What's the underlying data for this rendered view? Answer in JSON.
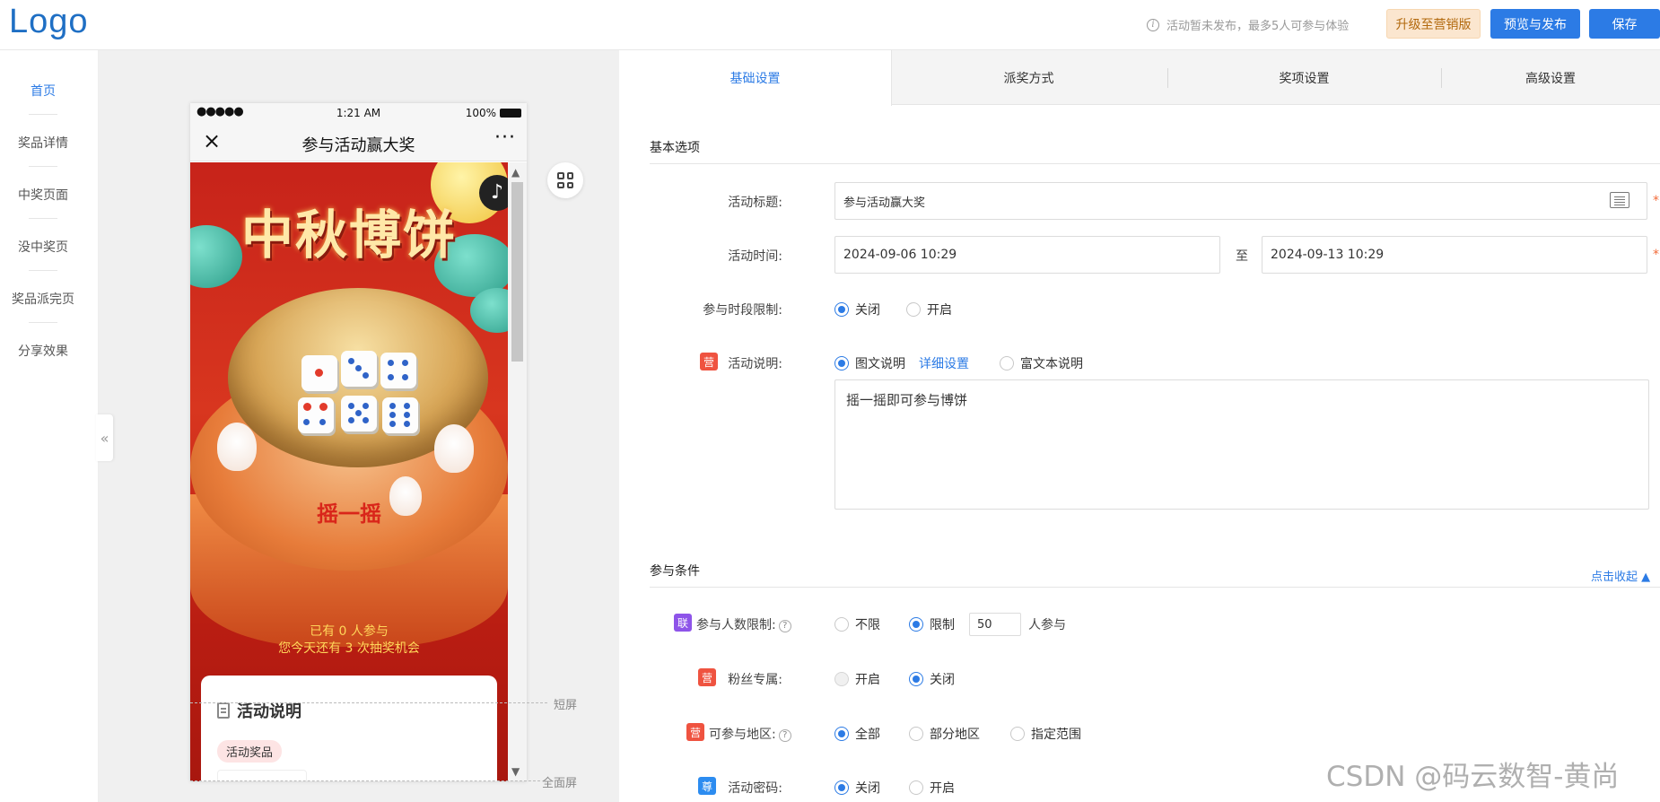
{
  "header": {
    "logo": "Logo",
    "hint": "活动暂未发布，最多5人可参与体验",
    "upgrade_label": "升级至营销版",
    "preview_label": "预览与发布",
    "save_label": "保存",
    "colors": {
      "primary": "#2c7be5",
      "upgrade_bg": "#fbe6cf",
      "upgrade_text": "#b2690d"
    }
  },
  "nav": {
    "items": [
      {
        "label": "首页",
        "active": true
      },
      {
        "label": "奖品详情"
      },
      {
        "label": "中奖页面"
      },
      {
        "label": "没中奖页"
      },
      {
        "label": "奖品派完页"
      },
      {
        "label": "分享效果"
      }
    ],
    "collapse_icon": "double-chevron-left-icon"
  },
  "phone": {
    "signal": "●●●●●",
    "time": "1:21 AM",
    "battery": "100%",
    "title": "参与活动赢大奖",
    "close_icon": "×",
    "more_icon": "···",
    "poster_title": "中秋博饼",
    "shake_label": "摇一摇",
    "joined_line1": "已有 0 人参与",
    "joined_line2": "您今天还有 3 次抽奖机会",
    "desc_title": "活动说明",
    "prize_tag": "活动奖品"
  },
  "canvas": {
    "short_screen": "短屏",
    "full_screen": "全面屏",
    "qr_icon": "qrcode-grid-icon"
  },
  "tabs": [
    {
      "label": "基础设置",
      "active": true
    },
    {
      "label": "派奖方式"
    },
    {
      "label": "奖项设置"
    },
    {
      "label": "高级设置"
    }
  ],
  "basic": {
    "section": "基本选项",
    "title_label": "活动标题:",
    "title_value": "参与活动赢大奖",
    "time_label": "活动时间:",
    "start_time": "2024-09-06 10:29",
    "to": "至",
    "end_time": "2024-09-13 10:29",
    "period_label": "参与时段限制:",
    "period_off": "关闭",
    "period_on": "开启",
    "desc_label": "活动说明:",
    "desc_badge": "营",
    "desc_opt1": "图文说明",
    "desc_link": "详细设置",
    "desc_opt2": "富文本说明",
    "desc_text": "摇一摇即可参与博饼",
    "required": "*"
  },
  "conditions": {
    "section": "参与条件",
    "collapse_link": "点击收起 ▲",
    "count_badge": "联",
    "count_label": "参与人数限制:",
    "count_opt1": "不限",
    "count_opt2": "限制",
    "count_value": "50",
    "count_suffix": "人参与",
    "fans_badge": "营",
    "fans_label": "粉丝专属:",
    "fans_on": "开启",
    "fans_off": "关闭",
    "region_badge": "营",
    "region_label": "可参与地区:",
    "region_opt1": "全部",
    "region_opt2": "部分地区",
    "region_opt3": "指定范围",
    "pwd_badge": "尊",
    "pwd_label": "活动密码:",
    "pwd_off": "关闭",
    "pwd_on": "开启"
  },
  "watermark": "CSDN @码云数智-黄尚"
}
